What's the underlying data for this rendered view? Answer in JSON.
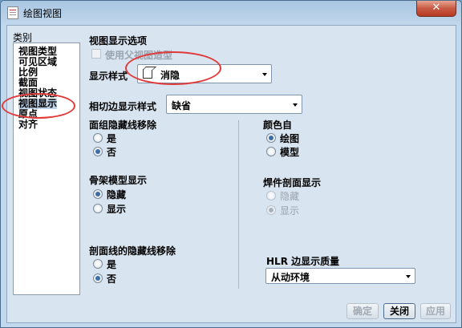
{
  "window": {
    "title": "绘图视图",
    "close_glyph": "✕"
  },
  "categories": {
    "label": "类别",
    "items": [
      "视图类型",
      "可见区域",
      "比例",
      "截面",
      "视图状态",
      "视图显示",
      "原点",
      "对齐"
    ],
    "selected_index": 5
  },
  "options": {
    "section_title": "视图显示选项",
    "use_parent_style": "使用父视图造型",
    "display_style_label": "显示样式",
    "display_style_value": "消隐",
    "tangent_label": "相切边显示样式",
    "tangent_value": "缺省"
  },
  "combined_hidden": {
    "title": "面组隐藏线移除",
    "opt_yes": "是",
    "opt_no": "否",
    "selected": "否"
  },
  "color_from": {
    "title": "颜色自",
    "opt_drawing": "绘图",
    "opt_model": "模型",
    "selected": "绘图"
  },
  "skeleton": {
    "title": "骨架模型显示",
    "opt_hide": "隐藏",
    "opt_show": "显示",
    "selected": "隐藏"
  },
  "weld": {
    "title": "焊件剖面显示",
    "opt_hide": "隐藏",
    "opt_show": "显示",
    "selected": "显示"
  },
  "xsec_hidden": {
    "title": "剖面线的隐藏线移除",
    "opt_yes": "是",
    "opt_no": "否",
    "selected": "否"
  },
  "hlr": {
    "title": "HLR 边显示质量",
    "value": "从动环境"
  },
  "buttons": {
    "ok": "确定",
    "close": "关闭",
    "apply": "应用"
  },
  "colors": {
    "annotation": "#e03a3a",
    "selection": "#bcd0e6",
    "radio_dot": "#3a6ea5"
  },
  "icons": {
    "display_style": "cube-icon",
    "app": "drawing-view-icon"
  }
}
